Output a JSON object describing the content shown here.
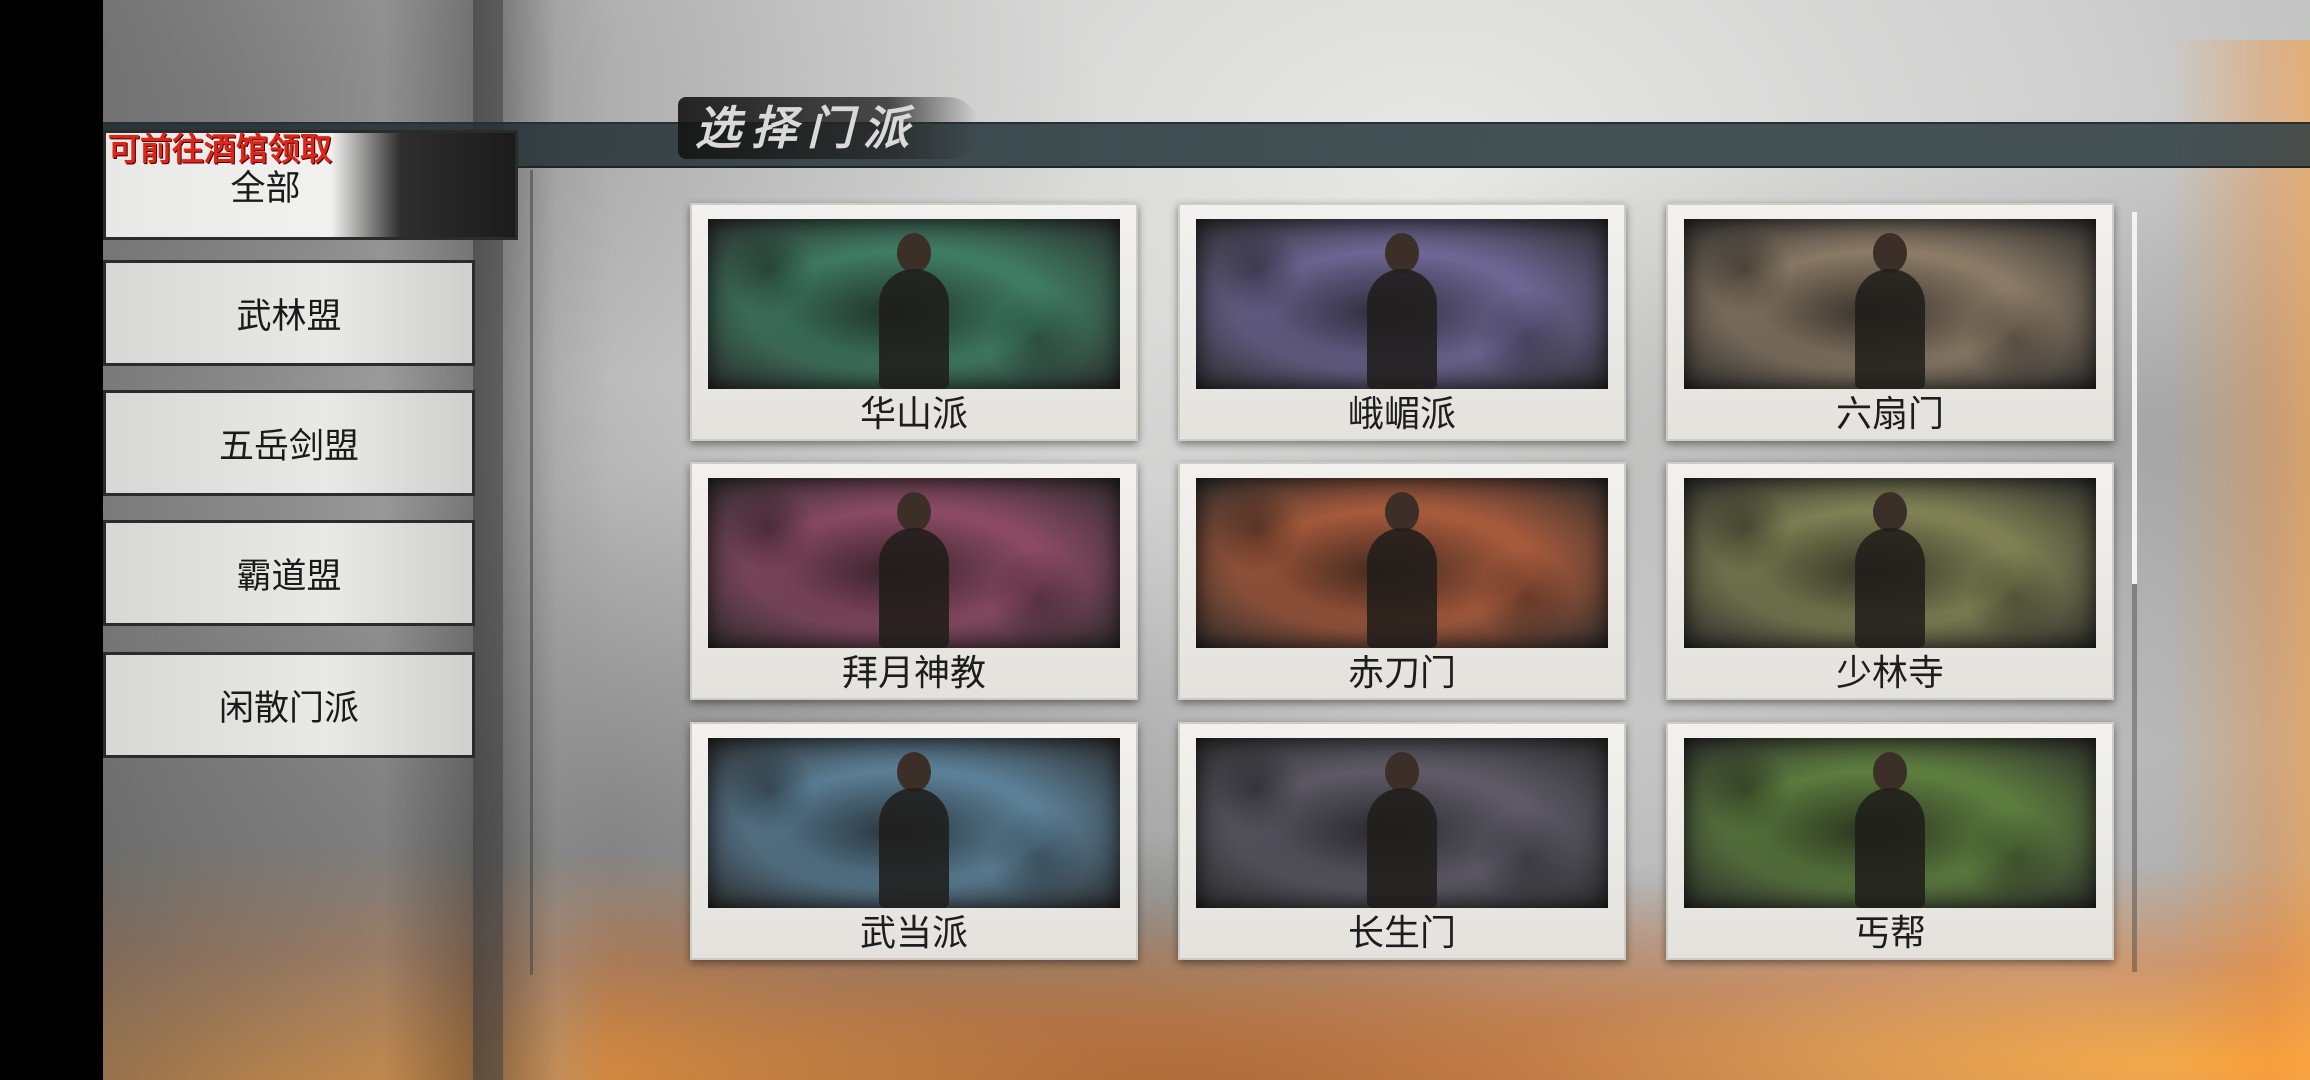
{
  "screen_title": "选择门派",
  "notice": "可前往酒馆领取",
  "tabs": [
    {
      "label": "全部",
      "active": true
    },
    {
      "label": "武林盟",
      "active": false
    },
    {
      "label": "五岳剑盟",
      "active": false
    },
    {
      "label": "霸道盟",
      "active": false
    },
    {
      "label": "闲散门派",
      "active": false
    }
  ],
  "sects": [
    {
      "name": "华山派",
      "art_color": "#3f7b64"
    },
    {
      "name": "峨嵋派",
      "art_color": "#6d6592"
    },
    {
      "name": "六扇门",
      "art_color": "#8a7a66"
    },
    {
      "name": "拜月神教",
      "art_color": "#8a4a63"
    },
    {
      "name": "赤刀门",
      "art_color": "#a65a3c"
    },
    {
      "name": "少林寺",
      "art_color": "#7f8154"
    },
    {
      "name": "武当派",
      "art_color": "#5b7f96"
    },
    {
      "name": "长生门",
      "art_color": "#5d5a66"
    },
    {
      "name": "丐帮",
      "art_color": "#5d7d3f"
    }
  ],
  "scroll": {
    "visible_fraction": 0.49
  }
}
